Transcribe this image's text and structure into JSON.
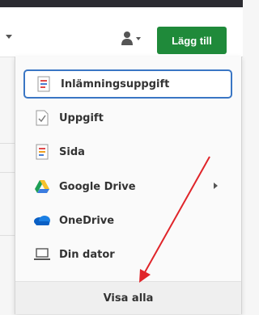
{
  "header": {
    "add_button_label": "Lägg till",
    "user_menu_icon": "user-icon"
  },
  "menu": {
    "items": [
      {
        "label": "Inlämningsuppgift",
        "icon": "assignment-icon",
        "selected": true
      },
      {
        "label": "Uppgift",
        "icon": "task-icon"
      },
      {
        "label": "Sida",
        "icon": "page-icon"
      },
      {
        "label": "Google Drive",
        "icon": "google-drive-icon",
        "has_submenu": true
      },
      {
        "label": "OneDrive",
        "icon": "onedrive-icon"
      },
      {
        "label": "Din dator",
        "icon": "laptop-icon"
      }
    ],
    "show_all_label": "Visa alla"
  },
  "colors": {
    "primary_button": "#1f8a3a",
    "selection_border": "#3a76c4",
    "annotation_arrow": "#e0252a"
  }
}
